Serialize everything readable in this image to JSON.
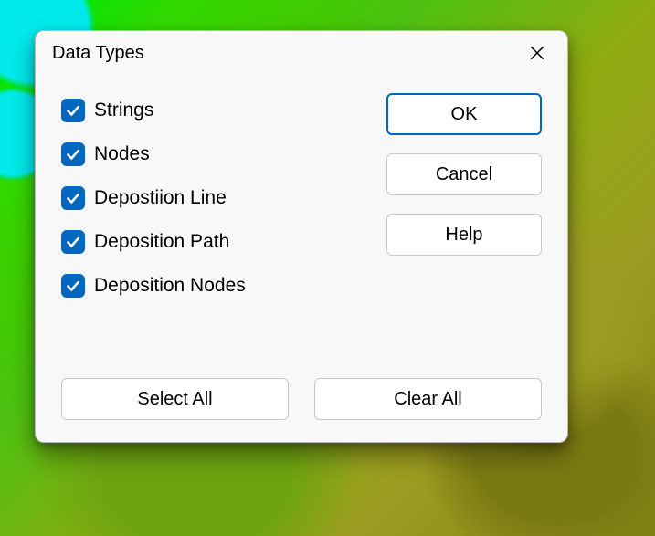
{
  "dialog": {
    "title": "Data Types",
    "checks": [
      {
        "label": "Strings",
        "checked": true
      },
      {
        "label": "Nodes",
        "checked": true
      },
      {
        "label": "Depostiion Line",
        "checked": true
      },
      {
        "label": "Deposition Path",
        "checked": true
      },
      {
        "label": "Deposition Nodes",
        "checked": true
      }
    ],
    "buttons": {
      "ok": "OK",
      "cancel": "Cancel",
      "help": "Help",
      "select_all": "Select All",
      "clear_all": "Clear All"
    }
  }
}
